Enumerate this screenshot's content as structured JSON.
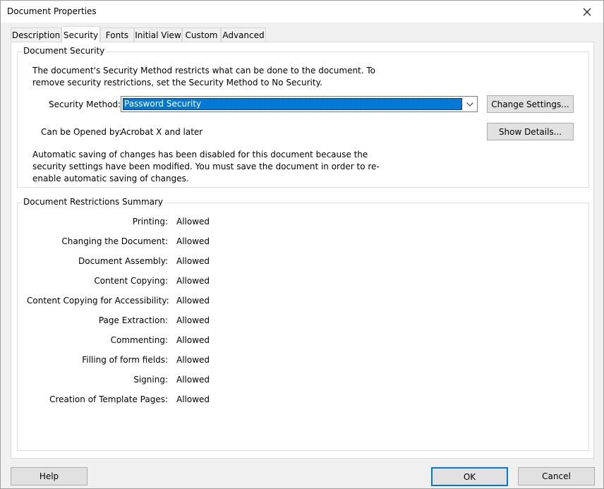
{
  "window": {
    "title": "Document Properties"
  },
  "tabs": [
    {
      "label": "Description"
    },
    {
      "label": "Security"
    },
    {
      "label": "Fonts"
    },
    {
      "label": "Initial View"
    },
    {
      "label": "Custom"
    },
    {
      "label": "Advanced"
    }
  ],
  "active_tab": "Security",
  "security": {
    "legend": "Document Security",
    "intro": "The document's Security Method restricts what can be done to the document. To remove security restrictions, set the Security Method to No Security.",
    "method_label": "Security Method:",
    "method_value": "Password Security",
    "change_settings_button": "Change Settings...",
    "opened_by_label": "Can be Opened by:",
    "opened_by_value": "Acrobat X and later",
    "show_details_button": "Show Details...",
    "autosave_note": "Automatic saving of changes has been disabled for this document because the security settings have been modified. You must save the document in order to re-enable automatic saving of changes."
  },
  "restrictions": {
    "legend": "Document Restrictions Summary",
    "rows": [
      {
        "label": "Printing:",
        "value": "Allowed"
      },
      {
        "label": "Changing the Document:",
        "value": "Allowed"
      },
      {
        "label": "Document Assembly:",
        "value": "Allowed"
      },
      {
        "label": "Content Copying:",
        "value": "Allowed"
      },
      {
        "label": "Content Copying for Accessibility:",
        "value": "Allowed"
      },
      {
        "label": "Page Extraction:",
        "value": "Allowed"
      },
      {
        "label": "Commenting:",
        "value": "Allowed"
      },
      {
        "label": "Filling of form fields:",
        "value": "Allowed"
      },
      {
        "label": "Signing:",
        "value": "Allowed"
      },
      {
        "label": "Creation of Template Pages:",
        "value": "Allowed"
      }
    ]
  },
  "footer": {
    "help_button": "Help",
    "ok_button": "OK",
    "cancel_button": "Cancel"
  },
  "icons": {
    "close": "close-icon",
    "dropdown": "chevron-down-icon"
  },
  "colors": {
    "selection": "#0078d7",
    "window_bg": "#f0f0f0",
    "panel_bg": "#ffffff"
  }
}
